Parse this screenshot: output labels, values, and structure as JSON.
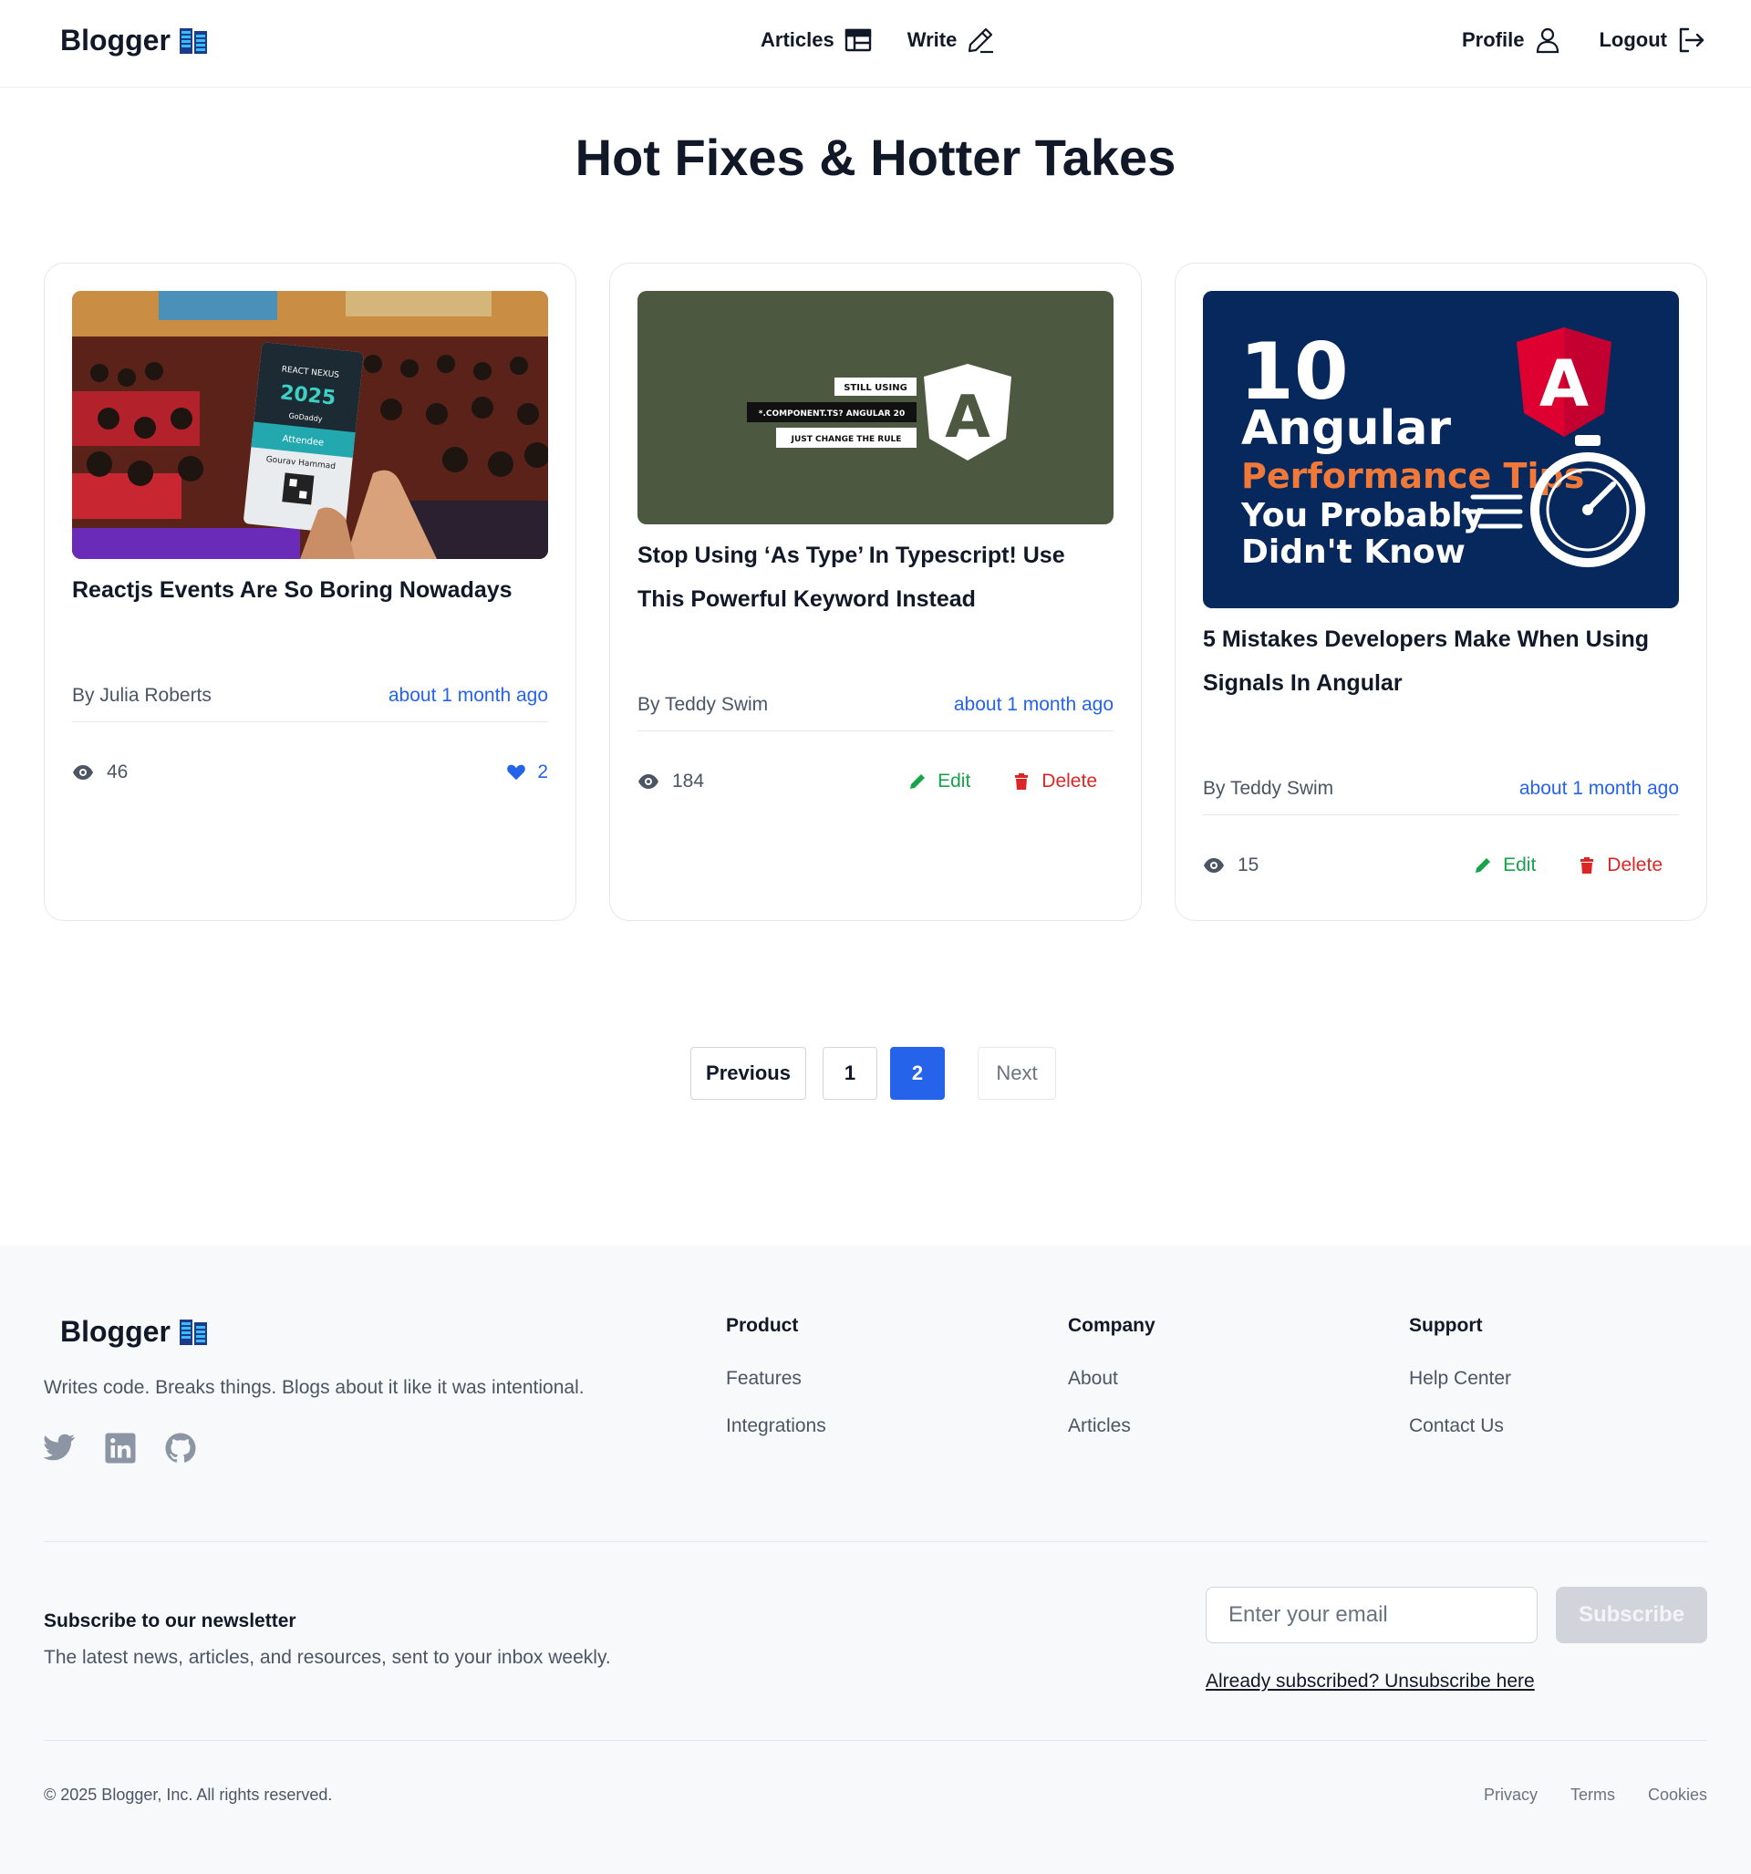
{
  "header": {
    "brand": "Blogger",
    "nav_center": [
      {
        "label": "Articles",
        "icon": "layout-icon"
      },
      {
        "label": "Write",
        "icon": "pencil-icon"
      }
    ],
    "nav_right": [
      {
        "label": "Profile",
        "icon": "user-icon"
      },
      {
        "label": "Logout",
        "icon": "logout-icon"
      }
    ]
  },
  "page_title": "Hot Fixes & Hotter Takes",
  "cards": [
    {
      "image": {
        "badge_lines": [
          "REACT NEXUS",
          "2025",
          "GoDaddy",
          "Attendee",
          "Gourav Hammad"
        ]
      },
      "title": "Reactjs Events Are So Boring Nowadays",
      "author": "By Julia Roberts",
      "time": "about 1 month ago",
      "views": "46",
      "likes": "2"
    },
    {
      "image": {
        "labels": [
          "STILL USING",
          "*.COMPONENT.TS? ANGULAR 20",
          "JUST CHANGE THE RULE"
        ],
        "logo_letter": "A"
      },
      "title": "Stop Using ‘As Type’ In Typescript! Use This Powerful Keyword Instead",
      "author": "By Teddy Swim",
      "time": "about 1 month ago",
      "views": "184",
      "edit_label": "Edit",
      "delete_label": "Delete"
    },
    {
      "image": {
        "number": "10",
        "line1": "Angular",
        "line2": "Performance Tips",
        "line3": "You Probably",
        "line4": "Didn't Know",
        "logo_letter": "A"
      },
      "title": "5 Mistakes Developers Make When Using Signals In Angular",
      "author": "By Teddy Swim",
      "time": "about 1 month ago",
      "views": "15",
      "edit_label": "Edit",
      "delete_label": "Delete"
    }
  ],
  "pagination": {
    "previous": "Previous",
    "pages": [
      "1",
      "2"
    ],
    "current": "2",
    "next": "Next"
  },
  "footer": {
    "brand": "Blogger",
    "tagline": "Writes code. Breaks things. Blogs about it like it was intentional.",
    "socials": [
      "twitter-icon",
      "linkedin-icon",
      "github-icon"
    ],
    "columns": [
      {
        "title": "Product",
        "links": [
          "Features",
          "Integrations"
        ]
      },
      {
        "title": "Company",
        "links": [
          "About",
          "Articles"
        ]
      },
      {
        "title": "Support",
        "links": [
          "Help Center",
          "Contact Us"
        ]
      }
    ],
    "newsletter": {
      "title": "Subscribe to our newsletter",
      "description": "The latest news, articles, and resources, sent to your inbox weekly.",
      "placeholder": "Enter your email",
      "button": "Subscribe",
      "unsubscribe": "Already subscribed? Unsubscribe here"
    },
    "copyright": "© 2025 Blogger, Inc. All rights reserved.",
    "legal": [
      "Privacy",
      "Terms",
      "Cookies"
    ]
  },
  "colors": {
    "accent": "#2563eb",
    "edit": "#16a34a",
    "delete": "#dc2626",
    "angular_red": "#dd0031",
    "angular_orange": "#f0793a",
    "card3_bg": "#06285c",
    "card2_bg": "#4d5841"
  }
}
